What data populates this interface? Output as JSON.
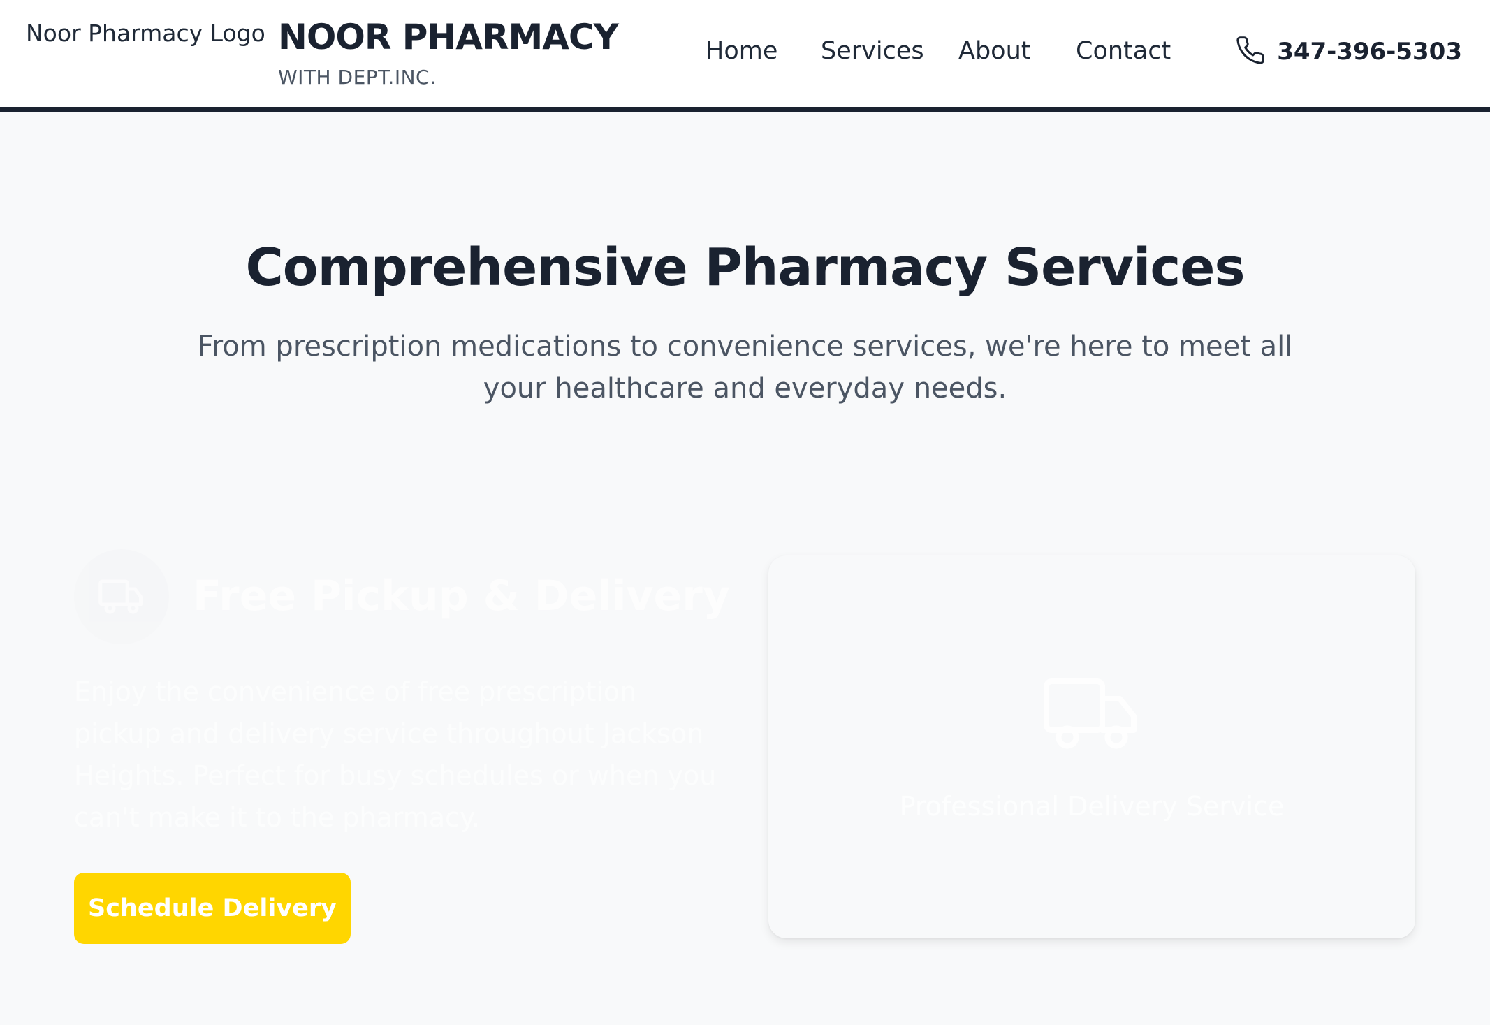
{
  "header": {
    "logo_alt": "Noor Pharmacy Logo",
    "brand_title": "NOOR PHARMACY",
    "brand_subtitle": "WITH DEPT.INC.",
    "nav": {
      "home": "Home",
      "services": "Services",
      "about": "About",
      "contact": "Contact"
    },
    "phone": "347-396-5303",
    "phone_icon": "phone-icon"
  },
  "hero": {
    "title": "Comprehensive Pharmacy Services",
    "subtitle": "From prescription medications to convenience services, we're here to meet all your healthcare and everyday needs."
  },
  "service": {
    "icon": "truck-icon",
    "title": "Free Pickup & Delivery",
    "description": "Enjoy the convenience of free prescription pickup and delivery service throughout Jackson Heights. Perfect for busy schedules or when you can't make it to the pharmacy.",
    "cta_label": "Schedule Delivery",
    "card_icon": "truck-icon",
    "card_caption": "Professional Delivery Service"
  },
  "colors": {
    "brand_dark": "#1a2230",
    "accent_yellow": "#ffd600",
    "page_bg": "#f8f9fa"
  }
}
